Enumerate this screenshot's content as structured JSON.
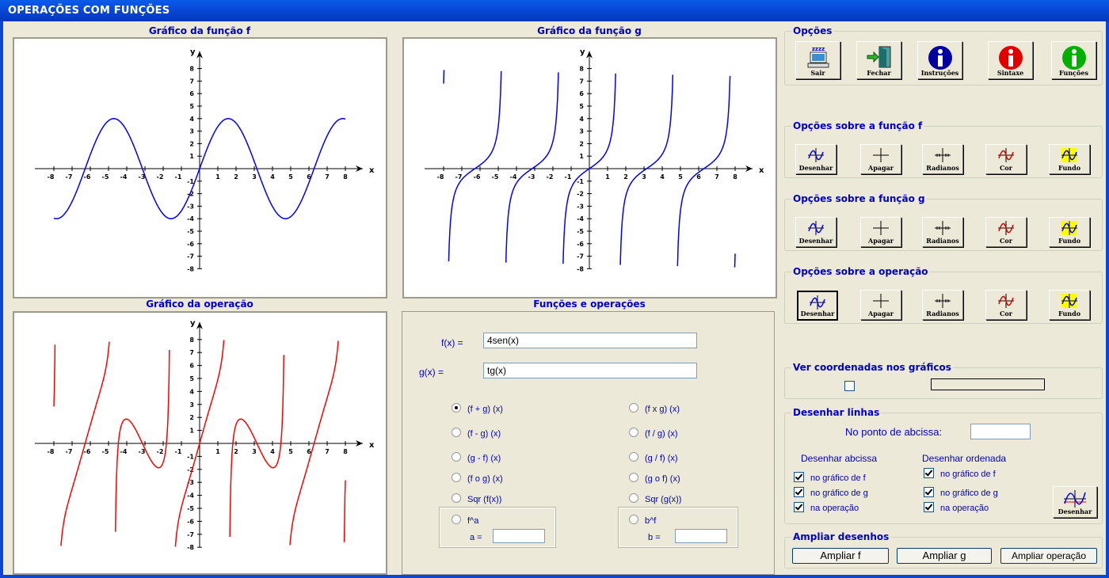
{
  "window": {
    "title": "OPERAÇÕES COM FUNÇÕES"
  },
  "panels": {
    "graph_f_title": "Gráfico da função f",
    "graph_g_title": "Gráfico da função g",
    "graph_op_title": "Gráfico da operação",
    "functions_title": "Funções e operações"
  },
  "axis": {
    "x_label": "x",
    "y_label": "y"
  },
  "chart_data": [
    {
      "type": "line",
      "name": "graph-f",
      "expression": "4sen(x)",
      "color": "#0000ff",
      "xlim": [
        -8,
        8
      ],
      "ylim": [
        -8,
        8
      ],
      "x_ticks": [
        -8,
        -7,
        -6,
        -5,
        -4,
        -3,
        -2,
        -1,
        1,
        2,
        3,
        4,
        5,
        6,
        7,
        8
      ],
      "y_ticks": [
        -8,
        -7,
        -6,
        -5,
        -4,
        -3,
        -2,
        -1,
        1,
        2,
        3,
        4,
        5,
        6,
        7,
        8
      ],
      "xlabel": "x",
      "ylabel": "y"
    },
    {
      "type": "line",
      "name": "graph-g",
      "expression": "tg(x)",
      "color": "#0000ff",
      "xlim": [
        -8,
        8
      ],
      "ylim": [
        -8,
        8
      ],
      "x_ticks": [
        -8,
        -7,
        -6,
        -5,
        -4,
        -3,
        -2,
        -1,
        1,
        2,
        3,
        4,
        5,
        6,
        7,
        8
      ],
      "y_ticks": [
        -8,
        -7,
        -6,
        -5,
        -4,
        -3,
        -2,
        -1,
        1,
        2,
        3,
        4,
        5,
        6,
        7,
        8
      ],
      "xlabel": "x",
      "ylabel": "y"
    },
    {
      "type": "line",
      "name": "graph-op",
      "expression": "(f + g) (x)",
      "color": "#ff0000",
      "xlim": [
        -8,
        8
      ],
      "ylim": [
        -8,
        8
      ],
      "x_ticks": [
        -8,
        -7,
        -6,
        -5,
        -4,
        -3,
        -2,
        -1,
        1,
        2,
        3,
        4,
        5,
        6,
        7,
        8
      ],
      "y_ticks": [
        -8,
        -7,
        -6,
        -5,
        -4,
        -3,
        -2,
        -1,
        1,
        2,
        3,
        4,
        5,
        6,
        7,
        8
      ],
      "xlabel": "x",
      "ylabel": "y"
    }
  ],
  "functions": {
    "f_label": "f(x) =",
    "f_value": "4sen(x)",
    "g_label": "g(x) =",
    "g_value": "tg(x)",
    "operations": [
      {
        "label": "(f + g) (x)",
        "selected": true
      },
      {
        "label": "(f x g) (x)",
        "selected": false
      },
      {
        "label": "(f - g) (x)",
        "selected": false
      },
      {
        "label": "(f / g) (x)",
        "selected": false
      },
      {
        "label": "(g - f) (x)",
        "selected": false
      },
      {
        "label": "(g / f) (x)",
        "selected": false
      },
      {
        "label": "(f o g) (x)",
        "selected": false
      },
      {
        "label": "(g o f) (x)",
        "selected": false
      },
      {
        "label": "Sqr (f(x))",
        "selected": false
      },
      {
        "label": "Sqr (g(x))",
        "selected": false
      },
      {
        "label": "f^a",
        "selected": false
      },
      {
        "label": "b^f",
        "selected": false
      }
    ],
    "a_label": "a =",
    "a_value": "",
    "b_label": "b =",
    "b_value": ""
  },
  "options": {
    "title": "Opções",
    "buttons": [
      {
        "label": "Sair",
        "icon": "computer-icon"
      },
      {
        "label": "Fechar",
        "icon": "exit-door-icon"
      },
      {
        "label": "Instruções",
        "icon": "info-icon",
        "color": "#0000a0"
      },
      {
        "label": "Sintaxe",
        "icon": "info-icon",
        "color": "#e00000"
      },
      {
        "label": "Funções",
        "icon": "info-icon",
        "color": "#00b000"
      }
    ]
  },
  "func_options": [
    {
      "title": "Opções sobre a função f",
      "buttons": [
        "Desenhar",
        "Apagar",
        "Radianos",
        "Cor",
        "Fundo"
      ]
    },
    {
      "title": "Opções sobre a função g",
      "buttons": [
        "Desenhar",
        "Apagar",
        "Radianos",
        "Cor",
        "Fundo"
      ]
    },
    {
      "title": "Opções sobre a operação",
      "buttons": [
        "Desenhar",
        "Apagar",
        "Radianos",
        "Cor",
        "Fundo"
      ]
    }
  ],
  "coords": {
    "title": "Ver coordenadas nos gráficos",
    "checked": false,
    "value": ""
  },
  "lines": {
    "title": "Desenhar linhas",
    "point_label": "No ponto de abcissa:",
    "point_value": "",
    "abscissa_title": "Desenhar abcissa",
    "ordinate_title": "Desenhar ordenada",
    "abscissa_items": [
      "no gráfico de f",
      "no gráfico de g",
      "na operação"
    ],
    "ordinate_items": [
      "no gráfico de f",
      "no gráfico de g",
      "na operação"
    ],
    "draw_button": "Desenhar"
  },
  "zoom": {
    "title": "Ampliar desenhos",
    "buttons": [
      "Ampliar f",
      "Ampliar g",
      "Ampliar operação"
    ]
  }
}
